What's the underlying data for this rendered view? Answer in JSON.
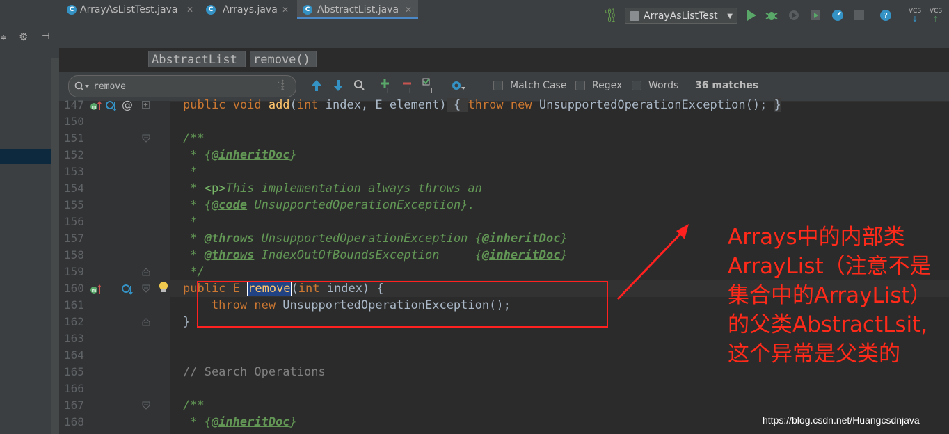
{
  "toolbar": {
    "run_config": "ArrayAsListTest",
    "vcs_update_label": "VCS",
    "vcs_commit_label": "VCS",
    "icons": [
      "run-icon",
      "debug-icon",
      "coverage-icon",
      "profile-icon",
      "stop-icon",
      "help-icon",
      "vcs-update-icon",
      "vcs-commit-icon"
    ]
  },
  "tabs": [
    {
      "label": "ArrayAsListTest.java",
      "active": false
    },
    {
      "label": "Arrays.java",
      "active": false
    },
    {
      "label": "AbstractList.java",
      "active": true
    }
  ],
  "breadcrumb": {
    "class": "AbstractList",
    "method": "remove()"
  },
  "search": {
    "value": "remove",
    "match_case": "Match Case",
    "regex": "Regex",
    "words": "Words",
    "matches": "36 matches"
  },
  "editor": {
    "lines": [
      {
        "no": "147",
        "code": ""
      },
      {
        "no": "150",
        "code": ""
      },
      {
        "no": "151",
        "code": ""
      },
      {
        "no": "152",
        "code": ""
      },
      {
        "no": "153",
        "code": ""
      },
      {
        "no": "154",
        "code": ""
      },
      {
        "no": "155",
        "code": ""
      },
      {
        "no": "156",
        "code": ""
      },
      {
        "no": "157",
        "code": ""
      },
      {
        "no": "158",
        "code": ""
      },
      {
        "no": "159",
        "code": ""
      },
      {
        "no": "160",
        "code": ""
      },
      {
        "no": "161",
        "code": ""
      },
      {
        "no": "162",
        "code": ""
      },
      {
        "no": "163",
        "code": ""
      },
      {
        "no": "164",
        "code": ""
      },
      {
        "no": "165",
        "code": ""
      },
      {
        "no": "166",
        "code": ""
      },
      {
        "no": "167",
        "code": ""
      },
      {
        "no": "168",
        "code": ""
      }
    ],
    "tokens": {
      "l147_a": "public void ",
      "l147_b": "add",
      "l147_c": "(",
      "l147_d": "int ",
      "l147_e": "index, E element)",
      "l147_f": " { ",
      "l147_g": "throw new ",
      "l147_h": "UnsupportedOperationException(); ",
      "l147_i": "}",
      "l151": "/**",
      "l152_a": " * {",
      "l152_b": "@inheritDoc",
      "l152_c": "}",
      "l153": " *",
      "l154_a": " * ",
      "l154_b": "<p>",
      "l154_c": "This implementation always throws an",
      "l155_a": " * {",
      "l155_b": "@code",
      "l155_c": " UnsupportedOperationException}.",
      "l156": " *",
      "l157_a": " * ",
      "l157_b": "@throws",
      "l157_c": " UnsupportedOperationException {",
      "l157_d": "@inheritDoc",
      "l157_e": "}",
      "l158_a": " * ",
      "l158_b": "@throws",
      "l158_c": " IndexOutOfBoundsException     {",
      "l158_d": "@inheritDoc",
      "l158_e": "}",
      "l159": " */",
      "l160_a": "public E ",
      "l160_b": "remove",
      "l160_c": "(",
      "l160_d": "int ",
      "l160_e": "index) {",
      "l161_a": "    throw new ",
      "l161_b": "UnsupportedOperationException();",
      "l162": "}",
      "l165": "// Search Operations",
      "l167": "/**",
      "l168_a": " * {",
      "l168_b": "@inheritDoc",
      "l168_c": "}"
    }
  },
  "annotation": {
    "lines": [
      "Arrays中的内部类",
      "ArrayList（注意不是",
      "集合中的ArrayList）",
      "的父类AbstractLsit,",
      "这个异常是父类的"
    ],
    "color": "#ff2a1a"
  },
  "watermark": "https://blog.csdn.net/Huangcsdnjava",
  "colors": {
    "keyword": "#cc7832",
    "doc": "#629755",
    "bg": "#2b2b2b",
    "accent": "#4a88c7"
  }
}
